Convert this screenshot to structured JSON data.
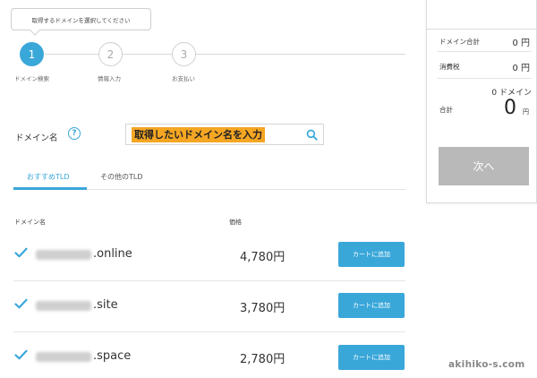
{
  "tooltip": {
    "text": "取得するドメインを選択してください"
  },
  "steps": [
    {
      "number": "1",
      "label": "ドメイン検索",
      "active": true
    },
    {
      "number": "2",
      "label": "情報入力",
      "active": false
    },
    {
      "number": "3",
      "label": "お支払い",
      "active": false
    }
  ],
  "search": {
    "label": "ドメイン名",
    "help": "?",
    "placeholder": "取得したいドメイン名を入力"
  },
  "tabs": [
    {
      "label": "おすすめTLD",
      "active": true
    },
    {
      "label": "その他のTLD",
      "active": false
    }
  ],
  "table": {
    "headers": {
      "domain": "ドメイン名",
      "price": "価格"
    },
    "rows": [
      {
        "tld": ".online",
        "price": "4,780円",
        "cart_label": "カートに追加"
      },
      {
        "tld": ".site",
        "price": "3,780円",
        "cart_label": "カートに追加"
      },
      {
        "tld": ".space",
        "price": "2,780円",
        "cart_label": "カートに追加"
      }
    ]
  },
  "summary": {
    "domain_total_label": "ドメイン合計",
    "domain_total_value": "0 円",
    "tax_label": "消費税",
    "tax_value": "0 円",
    "count": "0 ドメイン",
    "total_label": "合計",
    "total_value": "0",
    "total_unit": "円",
    "next_label": "次へ"
  },
  "watermark": "akihiko-s.com",
  "colors": {
    "accent": "#3aa7d9",
    "highlight": "#f5a623",
    "disabled": "#b9b9b9"
  }
}
